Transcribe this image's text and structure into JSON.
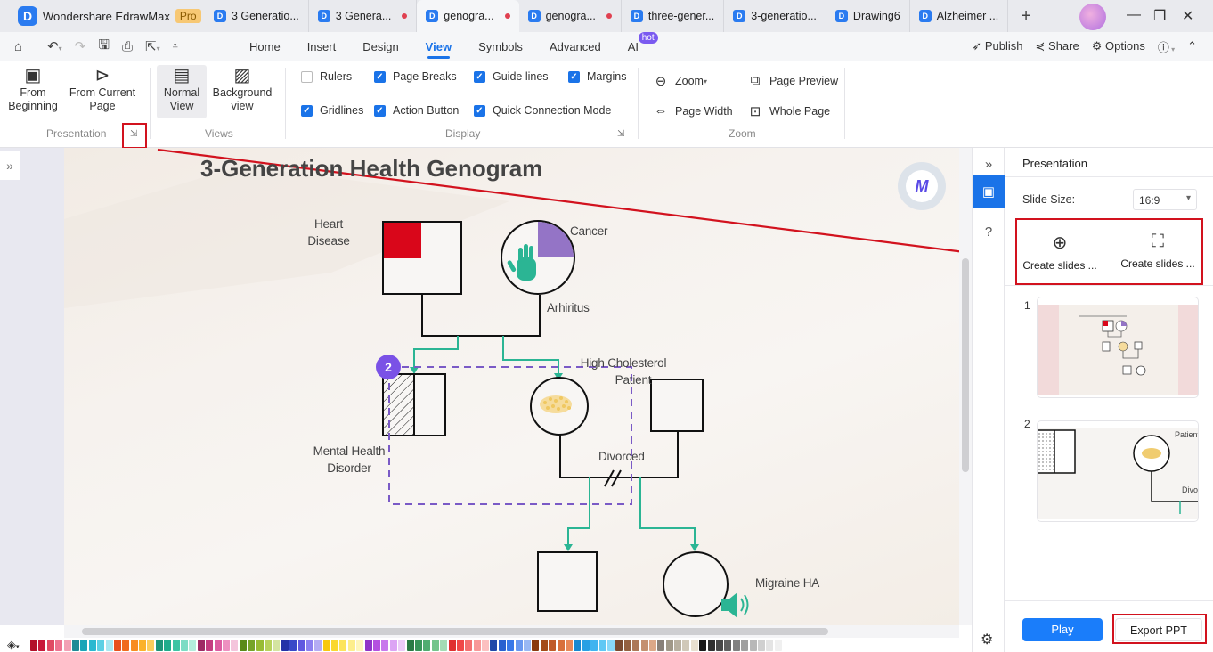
{
  "app": {
    "name": "Wondershare EdrawMax",
    "badge": "Pro",
    "logo_letter": "D"
  },
  "tabs": [
    {
      "label": "3 Generatio...",
      "unsaved": false,
      "active": false
    },
    {
      "label": "3 Genera...",
      "unsaved": true,
      "active": false
    },
    {
      "label": "genogra...",
      "unsaved": true,
      "active": true
    },
    {
      "label": "genogra...",
      "unsaved": true,
      "active": false
    },
    {
      "label": "three-gener...",
      "unsaved": false,
      "active": false
    },
    {
      "label": "3-generatio...",
      "unsaved": false,
      "active": false
    },
    {
      "label": "Drawing6",
      "unsaved": false,
      "active": false
    },
    {
      "label": "Alzheimer ...",
      "unsaved": false,
      "active": false
    }
  ],
  "icons": {
    "new_tab": "+",
    "minimize": "—",
    "restore": "❐",
    "close": "✕"
  },
  "menu": {
    "items": [
      "Home",
      "Insert",
      "Design",
      "View",
      "Symbols",
      "Advanced",
      "AI"
    ],
    "active": "View",
    "ai_badge": "hot",
    "right": {
      "publish": "Publish",
      "share": "Share",
      "options": "Options"
    }
  },
  "ribbon": {
    "presentation": {
      "from_beginning": "From\nBeginning",
      "from_beginning_l1": "From",
      "from_beginning_l2": "Beginning",
      "from_current_l1": "From Current",
      "from_current_l2": "Page",
      "label": "Presentation"
    },
    "views": {
      "normal_l1": "Normal",
      "normal_l2": "View",
      "background_l1": "Background",
      "background_l2": "view",
      "label": "Views"
    },
    "display": {
      "label": "Display",
      "checkboxes": [
        {
          "label": "Rulers",
          "checked": false
        },
        {
          "label": "Page Breaks",
          "checked": true
        },
        {
          "label": "Guide lines",
          "checked": true
        },
        {
          "label": "Margins",
          "checked": true
        },
        {
          "label": "Gridlines",
          "checked": true
        },
        {
          "label": "Action Button",
          "checked": true
        },
        {
          "label": "Quick Connection Mode",
          "checked": true
        }
      ]
    },
    "zoom": {
      "label": "Zoom",
      "zoom": "Zoom",
      "page_preview": "Page Preview",
      "page_width": "Page Width",
      "whole_page": "Whole Page"
    }
  },
  "canvas": {
    "title": "3-Generation Health Genogram",
    "labels": {
      "heart_l1": "Heart",
      "heart_l2": "Disease",
      "cancer": "Cancer",
      "arthritis": "Arhiritus",
      "cholesterol_l1": "High Cholesterol",
      "cholesterol_l2": "Patient",
      "mental_l1": "Mental Health",
      "mental_l2": "Disorder",
      "divorced": "Divorced",
      "migraine": "Migraine HA"
    },
    "action_badge": "2",
    "colors": {
      "heart": "#d9061a",
      "cancer": "#9474c6",
      "connector": "#2bb594",
      "selection": "#7a5ac6"
    }
  },
  "right_panel": {
    "title": "Presentation",
    "slide_size_label": "Slide Size:",
    "slide_size_value": "16:9",
    "create_1": "Create slides ...",
    "create_2": "Create slides ...",
    "slides": [
      {
        "number": "1"
      },
      {
        "number": "2"
      }
    ],
    "slide2_labels": {
      "patient": "Patient",
      "divorced": "Divorc"
    },
    "play": "Play",
    "export": "Export PPT"
  },
  "palette": [
    "#b3102a",
    "#c8183a",
    "#e04a64",
    "#ee7390",
    "#f2a0b4",
    "#1e8a96",
    "#1aa5b8",
    "#2ab8d0",
    "#5cd0e4",
    "#a8e8f2",
    "#e8501c",
    "#f06a1e",
    "#f88c22",
    "#fbb22a",
    "#fccd5c",
    "#1e9478",
    "#20ac8c",
    "#3cc4a4",
    "#7cdcc4",
    "#b4ecdc",
    "#9e2a64",
    "#c43c80",
    "#dc5ca0",
    "#ee90c0",
    "#f4c4dc",
    "#5a8a18",
    "#76a428",
    "#98bc34",
    "#b8d25c",
    "#d4e4a0",
    "#2432a8",
    "#3848c8",
    "#6058e0",
    "#8c80f0",
    "#b4acf4",
    "#f8c810",
    "#fad830",
    "#fce45c",
    "#fdee8c",
    "#fef6bc",
    "#9034c8",
    "#b450e0",
    "#c878ec",
    "#dca4f4",
    "#ecccf8",
    "#2a7a44",
    "#389458",
    "#50ac70",
    "#74c48c",
    "#a4dcb4",
    "#e03030",
    "#f04848",
    "#f47070",
    "#f89898",
    "#fcc0c0",
    "#2048a8",
    "#2860d0",
    "#3878e8",
    "#6898f0",
    "#98b8f4",
    "#8a3a10",
    "#a44a18",
    "#c05a28",
    "#d8703c",
    "#e88858",
    "#1888d0",
    "#28a0e4",
    "#40b4f0",
    "#60c8f4",
    "#88d8f8",
    "#7a4a30",
    "#946040",
    "#ac7858",
    "#c49070",
    "#dca888",
    "#888078",
    "#a09888",
    "#b8b0a0",
    "#d0c8b8",
    "#e8e0d0",
    "#181818",
    "#303030",
    "#484848",
    "#606060",
    "#808080",
    "#a0a0a0",
    "#b8b8b8",
    "#d0d0d0",
    "#e4e4e4",
    "#f0f0f0"
  ]
}
